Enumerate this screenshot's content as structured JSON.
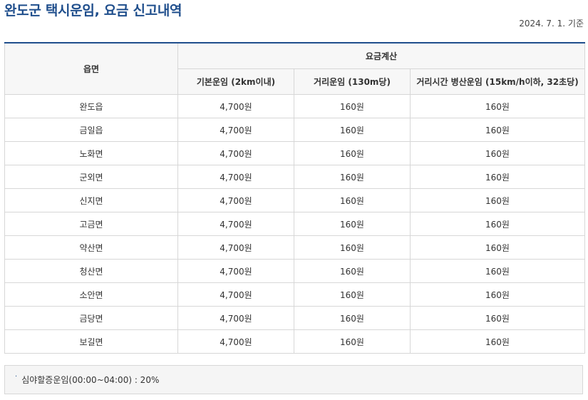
{
  "page": {
    "title": "완도군 택시운임, 요금 신고내역",
    "basis_date": "2024. 7. 1. 기준"
  },
  "table": {
    "header_region": "읍면",
    "header_group": "요금계산",
    "columns": [
      "기본운임 (2km이내)",
      "거리운임 (130m당)",
      "거리시간 병산운임 (15km/h이하, 32초당)"
    ],
    "rows": [
      {
        "region": "완도읍",
        "base": "4,700원",
        "distance": "160원",
        "time": "160원"
      },
      {
        "region": "금일읍",
        "base": "4,700원",
        "distance": "160원",
        "time": "160원"
      },
      {
        "region": "노화면",
        "base": "4,700원",
        "distance": "160원",
        "time": "160원"
      },
      {
        "region": "군외면",
        "base": "4,700원",
        "distance": "160원",
        "time": "160원"
      },
      {
        "region": "신지면",
        "base": "4,700원",
        "distance": "160원",
        "time": "160원"
      },
      {
        "region": "고금면",
        "base": "4,700원",
        "distance": "160원",
        "time": "160원"
      },
      {
        "region": "약산면",
        "base": "4,700원",
        "distance": "160원",
        "time": "160원"
      },
      {
        "region": "청산면",
        "base": "4,700원",
        "distance": "160원",
        "time": "160원"
      },
      {
        "region": "소안면",
        "base": "4,700원",
        "distance": "160원",
        "time": "160원"
      },
      {
        "region": "금당면",
        "base": "4,700원",
        "distance": "160원",
        "time": "160원"
      },
      {
        "region": "보길면",
        "base": "4,700원",
        "distance": "160원",
        "time": "160원"
      }
    ]
  },
  "note": {
    "bullet": "·",
    "text": "심야할증운임(00:00~04:00) : 20%"
  },
  "colors": {
    "accent": "#1f4e8c",
    "border": "#d7d7d7",
    "header_bg": "#f7f7f7"
  }
}
